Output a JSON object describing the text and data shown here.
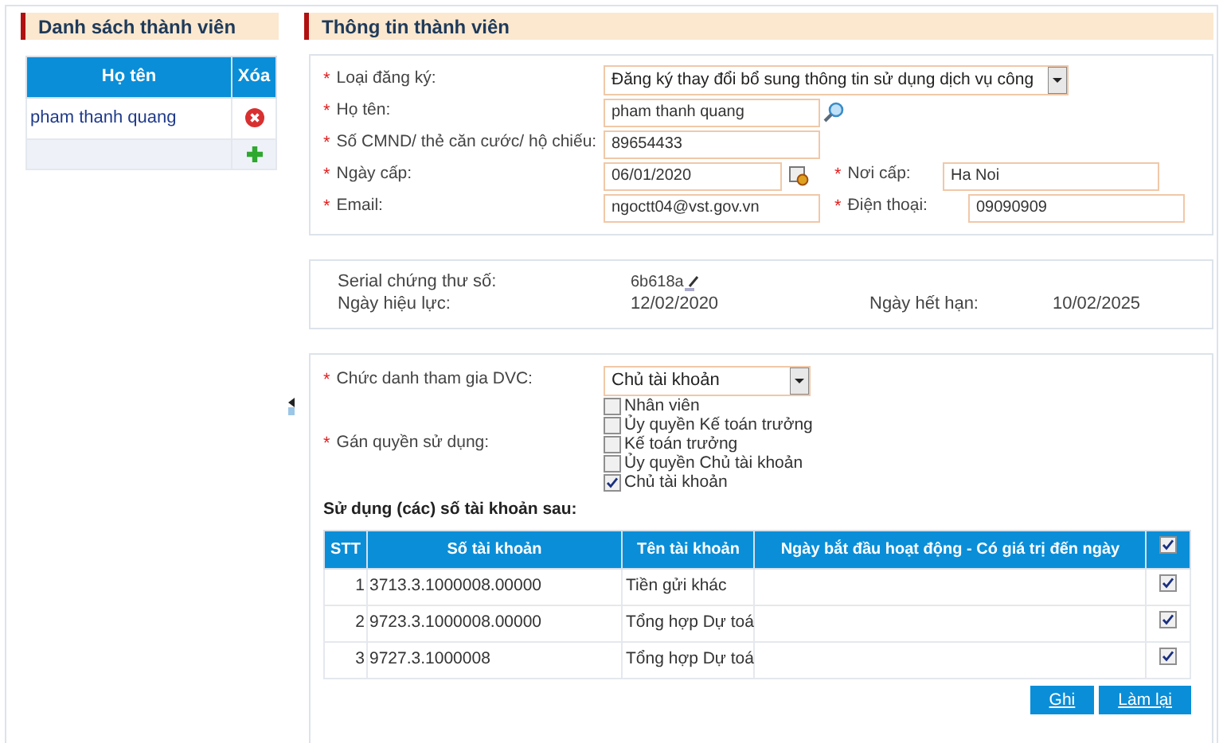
{
  "members_panel": {
    "title": "Danh sách thành viên",
    "columns": [
      "Họ tên",
      "Xóa"
    ],
    "rows": [
      {
        "name": "pham thanh quang"
      }
    ]
  },
  "info_panel": {
    "title": "Thông tin thành viên",
    "fields": {
      "registration_type": {
        "label": "Loại đăng ký:",
        "value": "Đăng ký thay đổi bổ sung thông tin sử dụng dịch vụ công",
        "mark": "*"
      },
      "full_name": {
        "label": "Họ tên:",
        "value": "pham thanh quang",
        "mark": "*"
      },
      "id_number": {
        "label": "Số CMND/ thẻ căn cước/ hộ chiếu:",
        "value": "89654433",
        "mark": "*"
      },
      "issue_date": {
        "label": "Ngày cấp:",
        "value": "06/01/2020",
        "mark": "*"
      },
      "issue_place": {
        "label": "Nơi cấp:",
        "value": "Ha Noi",
        "mark": "*"
      },
      "email": {
        "label": "Email:",
        "value": "ngoctt04@vst.gov.vn",
        "mark": "*"
      },
      "phone": {
        "label": "Điện thoại:",
        "value": "09090909",
        "mark": "*"
      }
    },
    "certificate": {
      "serial_label": "Serial chứng thư số:",
      "serial_value": "6b618a",
      "valid_from_label": "Ngày hiệu lực:",
      "valid_from": "12/02/2020",
      "valid_to_label": "Ngày hết hạn:",
      "valid_to": "10/02/2025"
    },
    "role": {
      "label": "Chức danh tham gia DVC:",
      "value": "Chủ tài khoản",
      "mark": "*"
    },
    "permissions": {
      "label": "Gán quyền sử dụng:",
      "mark": "*",
      "options": [
        {
          "label": "Nhân viên",
          "checked": false
        },
        {
          "label": "Ủy quyền Kế toán trưởng",
          "checked": false
        },
        {
          "label": "Kế toán trưởng",
          "checked": false
        },
        {
          "label": "Ủy quyền Chủ tài khoản",
          "checked": false
        },
        {
          "label": "Chủ tài khoản",
          "checked": true
        }
      ]
    },
    "accounts": {
      "title": "Sử dụng (các) số tài khoản sau:",
      "columns": [
        "STT",
        "Số tài khoản",
        "Tên tài khoản",
        "Ngày bắt đầu hoạt động - Có giá trị đến ngày"
      ],
      "all_checked": true,
      "rows": [
        {
          "stt": "1",
          "number": "3713.3.1000008.00000",
          "name": "Tiền gửi khác",
          "checked": true
        },
        {
          "stt": "2",
          "number": "9723.3.1000008.00000",
          "name": "Tổng hợp Dự toá",
          "checked": true
        },
        {
          "stt": "3",
          "number": "9727.3.1000008",
          "name": "Tổng hợp Dự toá",
          "checked": true
        }
      ]
    },
    "buttons": [
      "Ghi",
      "Làm lại"
    ]
  }
}
